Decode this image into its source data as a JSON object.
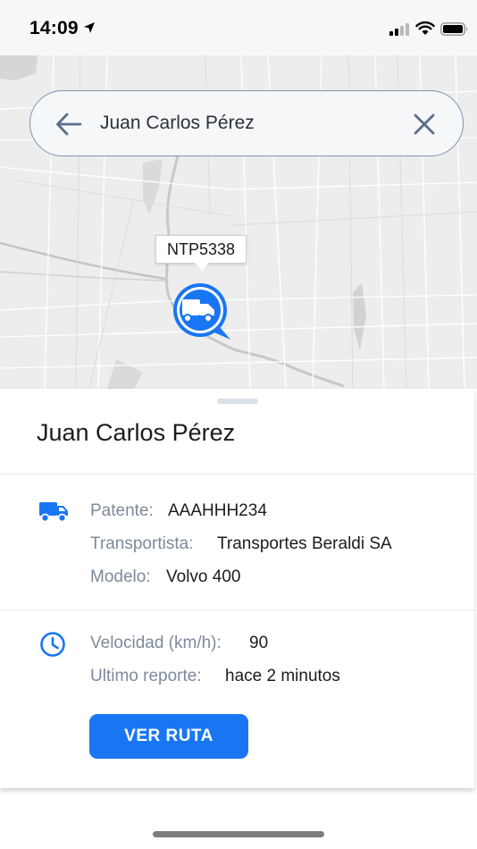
{
  "status_bar": {
    "time": "14:09",
    "icons": [
      "location-arrow-icon",
      "cellular-signal-icon",
      "wifi-icon",
      "battery-icon"
    ]
  },
  "search": {
    "value": "Juan Carlos Pérez",
    "icons": [
      "arrow-left-icon",
      "close-icon"
    ]
  },
  "map": {
    "vehicle_label": "NTP5338",
    "marker_icon": "truck-icon",
    "accent_color": "#1976f3"
  },
  "sheet": {
    "title": "Juan Carlos Pérez",
    "vehicle": {
      "icon": "truck-icon",
      "patente_label": "Patente:",
      "patente_value": "AAAHHH234",
      "transportista_label": "Transportista:",
      "transportista_value": "Transportes Beraldi SA",
      "modelo_label": "Modelo:",
      "modelo_value": "Volvo 400"
    },
    "status": {
      "icon": "clock-icon",
      "velocidad_label": "Velocidad (km/h):",
      "velocidad_value": "90",
      "reporte_label": "Ultimo reporte:",
      "reporte_value": "hace 2 minutos"
    },
    "route_button": "VER RUTA"
  }
}
